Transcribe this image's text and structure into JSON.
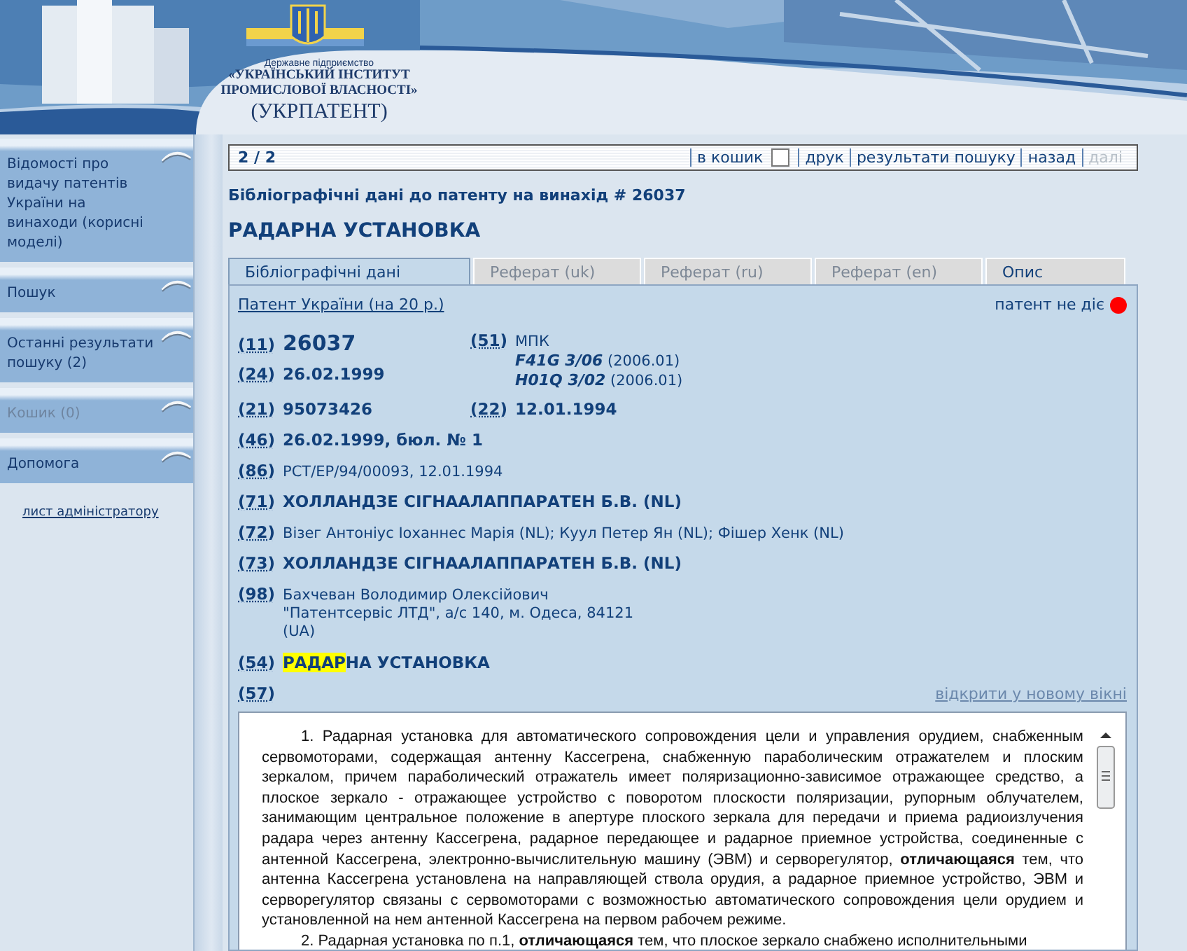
{
  "header": {
    "org_type": "Державне підприємство",
    "org_name_1": "«УКРАЇНСЬКИЙ ІНСТИТУТ",
    "org_name_2": "ПРОМИСЛОВОЇ ВЛАСНОСТІ»",
    "short_name": "(УКРПАТЕНТ)"
  },
  "sidebar": {
    "items": [
      {
        "label": "Відомості про видачу патентів України на винаходи (корисні моделі)",
        "disabled": false
      },
      {
        "label": "Пошук",
        "disabled": false
      },
      {
        "label": "Останні результати пошуку (2)",
        "disabled": false
      },
      {
        "label": "Кошик (0)",
        "disabled": true
      },
      {
        "label": "Допомога",
        "disabled": false
      }
    ],
    "admin_link": "лист адміністратору"
  },
  "toolbar": {
    "counter": "2 / 2",
    "cart": {
      "label": "в кошик",
      "checked": false
    },
    "links": [
      {
        "label": "друк",
        "disabled": false
      },
      {
        "label": "результати пошуку",
        "disabled": false
      },
      {
        "label": "назад",
        "disabled": false
      },
      {
        "label": "далі",
        "disabled": true
      }
    ]
  },
  "subtitle": "Бібліографічні дані до патенту на винахід # 26037",
  "title": "РАДАРНА УСТАНОВКА",
  "tabs": [
    {
      "label": "Бібліографічні дані",
      "selected": true,
      "disabled": false
    },
    {
      "label": "Реферат (uk)",
      "selected": false,
      "disabled": true
    },
    {
      "label": "Реферат (ru)",
      "selected": false,
      "disabled": true
    },
    {
      "label": "Реферат (en)",
      "selected": false,
      "disabled": true
    },
    {
      "label": "Опис",
      "selected": false,
      "disabled": false
    }
  ],
  "patent_link": "Патент України (на 20 р.)",
  "status": {
    "label": "патент не діє",
    "active": false
  },
  "pairs": [
    {
      "left": [
        {
          "code": "(11)",
          "kind": "number",
          "value": "26037"
        },
        {
          "code": "(24)",
          "kind": "bold",
          "value": "26.02.1999"
        }
      ],
      "right": [
        {
          "code": "(51)",
          "kind": "classes",
          "value": "МПК",
          "classes": [
            {
              "code": "F41G 3/06",
              "version": "(2006.01)"
            },
            {
              "code": "H01Q 3/02",
              "version": "(2006.01)"
            }
          ]
        }
      ]
    },
    {
      "left": [
        {
          "code": "(21)",
          "kind": "bold",
          "value": "95073426"
        }
      ],
      "right": [
        {
          "code": "(22)",
          "kind": "bold",
          "value": "12.01.1994"
        }
      ]
    }
  ],
  "rows": [
    {
      "code": "(46)",
      "kind": "bold",
      "value": "26.02.1999, бюл. № 1"
    },
    {
      "code": "(86)",
      "kind": "plain",
      "value": "PCT/EP/94/00093, 12.01.1994"
    },
    {
      "code": "(71)",
      "kind": "bold",
      "value": "ХОЛЛАНДЗЕ СІГНААЛАППАРАТЕН Б.В. (NL)"
    },
    {
      "code": "(72)",
      "kind": "plain",
      "value": "Візег Антоніус Іоханнес Марія (NL); Куул Петер Ян (NL); Фішер Хенк (NL)"
    },
    {
      "code": "(73)",
      "kind": "bold",
      "value": "ХОЛЛАНДЗЕ СІГНААЛАППАРАТЕН Б.В. (NL)"
    },
    {
      "code": "(98)",
      "kind": "lines",
      "lines": [
        "Бахчеван Володимир Олексійович",
        "\"Патентсервіс ЛТД\", а/с 140, м. Одеса, 84121",
        "(UA)"
      ]
    },
    {
      "code": "(54)",
      "kind": "highlight",
      "highlight": "РАДАР",
      "value": "НА УСТАНОВКА"
    },
    {
      "code": "(57)",
      "kind": "link",
      "value": "відкрити у новому вікні"
    }
  ],
  "claims": [
    "1. Радарная установка для автоматического сопровождения цели и управления орудием, снабженным сервомоторами, содержащая антенну Кассегрена, снабженную параболическим отражателем и плоским зеркалом, причем параболический отражатель имеет поляризационно-зависимое отражающее средство, а плоское зеркало - отражающее устройство с поворотом плоскости поляризации, рупорным облучателем, занимающим центральное положение в апертуре плоского зеркала для передачи и приема радиоизлучения радара через антенну Кассегрена, радарное передающее и радарное приемное устройства, соединенные с антенной Кассегрена, электронно-вычислительную машину (ЭВМ) и серворегулятор, **отличающаяся** тем, что антенна Кассегрена установлена на направляющей ствола орудия, а радарное приемное устройство, ЭВМ и серворегулятор связаны с сервомоторами с возможностью автоматического сопровождения цели орудием и установленной на нем антенной Кассегрена на первом рабочем режиме.",
    "2. Радарная установка по п.1, **отличающаяся** тем, что плоское зеркало снабжено исполнительными"
  ]
}
